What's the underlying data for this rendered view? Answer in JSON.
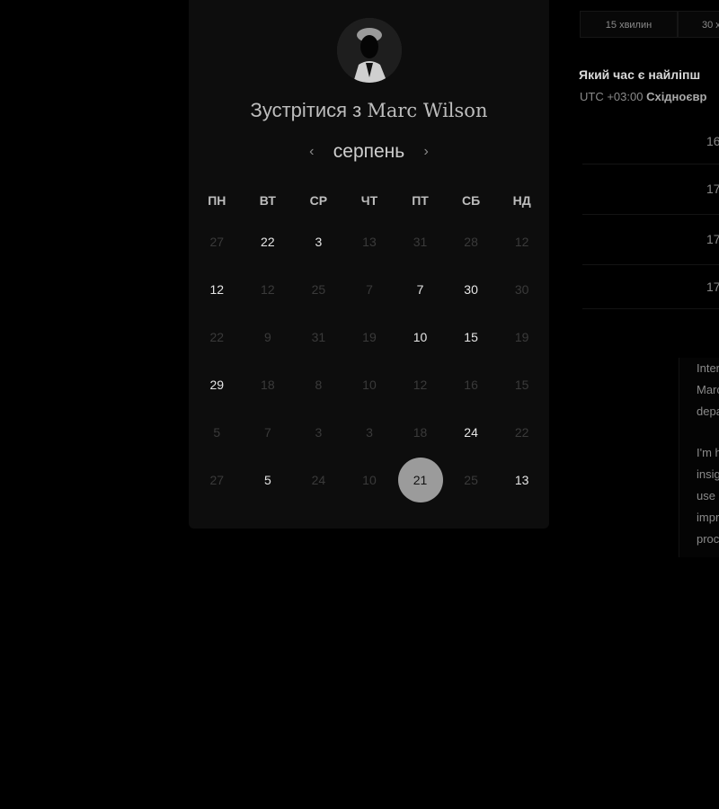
{
  "host": {
    "prefix": "Зустрітися з ",
    "name": "Marc Wilson"
  },
  "calendar": {
    "month": "серпень",
    "prev_icon": "chevron-left-icon",
    "next_icon": "chevron-right-icon",
    "weekdays": [
      "ПН",
      "ВТ",
      "СР",
      "ЧТ",
      "ПТ",
      "СБ",
      "НД"
    ],
    "weeks": [
      [
        {
          "d": "27",
          "on": false
        },
        {
          "d": "22",
          "on": true
        },
        {
          "d": "3",
          "on": true
        },
        {
          "d": "13",
          "on": false
        },
        {
          "d": "31",
          "on": false
        },
        {
          "d": "28",
          "on": false
        },
        {
          "d": "12",
          "on": false
        }
      ],
      [
        {
          "d": "12",
          "on": true
        },
        {
          "d": "12",
          "on": false
        },
        {
          "d": "25",
          "on": false
        },
        {
          "d": "7",
          "on": false
        },
        {
          "d": "7",
          "on": true
        },
        {
          "d": "30",
          "on": true
        },
        {
          "d": "30",
          "on": false
        }
      ],
      [
        {
          "d": "22",
          "on": false
        },
        {
          "d": "9",
          "on": false
        },
        {
          "d": "31",
          "on": false
        },
        {
          "d": "19",
          "on": false
        },
        {
          "d": "10",
          "on": true
        },
        {
          "d": "15",
          "on": true
        },
        {
          "d": "19",
          "on": false
        }
      ],
      [
        {
          "d": "29",
          "on": true
        },
        {
          "d": "18",
          "on": false
        },
        {
          "d": "8",
          "on": false
        },
        {
          "d": "10",
          "on": false
        },
        {
          "d": "12",
          "on": false
        },
        {
          "d": "16",
          "on": false
        },
        {
          "d": "15",
          "on": false
        }
      ],
      [
        {
          "d": "5",
          "on": false
        },
        {
          "d": "7",
          "on": false
        },
        {
          "d": "3",
          "on": false
        },
        {
          "d": "3",
          "on": false
        },
        {
          "d": "18",
          "on": false
        },
        {
          "d": "24",
          "on": true
        },
        {
          "d": "22",
          "on": false
        }
      ],
      [
        {
          "d": "27",
          "on": false
        },
        {
          "d": "5",
          "on": true
        },
        {
          "d": "24",
          "on": false
        },
        {
          "d": "10",
          "on": false
        },
        {
          "d": "21",
          "on": true,
          "selected": true
        },
        {
          "d": "25",
          "on": false
        },
        {
          "d": "13",
          "on": true
        }
      ]
    ]
  },
  "durations": [
    "15 хвилин",
    "30 х"
  ],
  "question": "Який час є найліпш",
  "timezone": {
    "offset": "UTC +03:00 ",
    "zone": "Східноєвр"
  },
  "slots": [
    "16",
    "17",
    "17",
    "17"
  ],
  "bio": {
    "lines_1": [
      "Inter",
      "Marc",
      "depa"
    ],
    "lines_2": [
      "I'm h",
      "insig",
      "use",
      "impr",
      "proc"
    ]
  },
  "colors": {
    "background": "#000000",
    "card": "#0d0d0d",
    "selected_day": "#9b9b9b"
  }
}
